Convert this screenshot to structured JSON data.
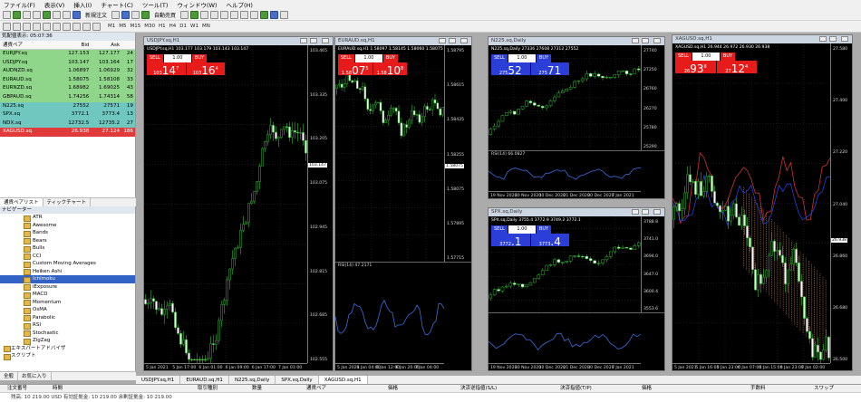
{
  "menu": [
    "ファイル(F)",
    "表示(V)",
    "挿入(I)",
    "チャート(C)",
    "ツール(T)",
    "ウィンドウ(W)",
    "ヘルプ(H)"
  ],
  "toolbar": {
    "new_order": "新規注文",
    "auto_trade": "自動売買"
  },
  "timeframes": [
    "M1",
    "M5",
    "M15",
    "M30",
    "H1",
    "H4",
    "D1",
    "W1",
    "MN"
  ],
  "market_watch": {
    "title": "気配値表示: 05:07:36",
    "headers": [
      "通貨ペア",
      "Bid",
      "Ask",
      ""
    ],
    "rows": [
      {
        "sym": "EURJPY.sq",
        "bid": "127.153",
        "ask": "127.177",
        "sp": "24",
        "bg": "#8fd68a"
      },
      {
        "sym": "USDJPY.sq",
        "bid": "103.147",
        "ask": "103.164",
        "sp": "17",
        "bg": "#8fd68a"
      },
      {
        "sym": "AUDNZD.sq",
        "bid": "1.06897",
        "ask": "1.06929",
        "sp": "32",
        "bg": "#8fd68a"
      },
      {
        "sym": "EURAUD.sq",
        "bid": "1.58075",
        "ask": "1.58108",
        "sp": "33",
        "bg": "#8fd68a"
      },
      {
        "sym": "EURNZD.sq",
        "bid": "1.68982",
        "ask": "1.69025",
        "sp": "43",
        "bg": "#8fd68a"
      },
      {
        "sym": "GBPAUD.sq",
        "bid": "1.74256",
        "ask": "1.74314",
        "sp": "58",
        "bg": "#8fd68a"
      },
      {
        "sym": "N225.sq",
        "bid": "27552",
        "ask": "27571",
        "sp": "19",
        "bg": "#6fc7bf"
      },
      {
        "sym": "SPX.sq",
        "bid": "3772.1",
        "ask": "3773.4",
        "sp": "13",
        "bg": "#6fc7bf"
      },
      {
        "sym": "NDX.sq",
        "bid": "12732.5",
        "ask": "12735.2",
        "sp": "27",
        "bg": "#6fc7bf"
      },
      {
        "sym": "XAGUSD.sq",
        "bid": "26.938",
        "ask": "27.124",
        "sp": "186",
        "bg": "#e03a3a",
        "fg": "#fff"
      }
    ],
    "tabs": [
      "通貨ペアリスト",
      "ティックチャート"
    ]
  },
  "navigator": {
    "title": "ナビゲーター",
    "items": [
      "ATR",
      "Awesome",
      "Bands",
      "Bears",
      "Bulls",
      "CCI",
      "Custom Moving Averages",
      "Heiken Ashi",
      "Ichimoku",
      "iExposure",
      "MACD",
      "Momentum",
      "OsMA",
      "Parabolic",
      "RSI",
      "Stochastic",
      "ZigZag"
    ],
    "selected": "Ichimoku",
    "roots": [
      "エキスパートアドバイザ",
      "スクリプト"
    ],
    "tabs": [
      "全般",
      "お気に入り"
    ]
  },
  "charts": {
    "usdjpy": {
      "title": "USDJPY.sq,H1",
      "info": "USDJPY.sq,H1  103.177 103.179 103.143 103.147",
      "sell": "SELL",
      "buy": "BUY",
      "lot": "1.00",
      "bid_pre": "103",
      "bid_big": "14",
      "bid_sup": "7",
      "ask_pre": "103",
      "ask_big": "16",
      "ask_sup": "4",
      "yticks": [
        "103.465",
        "103.335",
        "103.205",
        "103.075",
        "102.945",
        "102.815",
        "102.685",
        "102.555"
      ],
      "price_tag": "103.147",
      "xticks": [
        "5 Jan 2021",
        "5 Jan 17:00",
        "6 Jan 01:00",
        "6 Jan 09:00",
        "6 Jan 17:00",
        "7 Jan 01:00"
      ]
    },
    "euraud": {
      "title": "EURAUD.sq,H1",
      "info": "EURAUD.sq,H1  1.58097 1.58145 1.58060 1.58075",
      "sell": "SELL",
      "buy": "BUY",
      "lot": "1.00",
      "bid_pre": "1.58",
      "bid_big": "07",
      "bid_sup": "5",
      "ask_pre": "1.58",
      "ask_big": "10",
      "ask_sup": "8",
      "yticks": [
        "1.58795",
        "1.58615",
        "1.58435",
        "1.58255",
        "1.58075",
        "1.57895",
        "1.57715"
      ],
      "price_tag": "1.58075",
      "rsi": "RSI(14) 47.2171",
      "xticks": [
        "5 Jan 2021",
        "6 Jan 04:00",
        "6 Jan 12:00",
        "6 Jan 20:00",
        "7 Jan 04:00"
      ]
    },
    "n225": {
      "title": "N225.sq,Daily",
      "info": "N225.sq,Daily  27336 27608 27312 27552",
      "sell": "SELL",
      "buy": "BUY",
      "lot": "1.00",
      "bid_pre": "275",
      "bid_big": "52",
      "bid_sup": "",
      "ask_pre": "275",
      "ask_big": "71",
      "ask_sup": "",
      "yticks": [
        "27740",
        "27250",
        "26760",
        "26270",
        "25780",
        "25290"
      ],
      "rsi": "RSI(14) 66.0827",
      "xticks": [
        "19 Nov 2020",
        "30 Nov 2020",
        "10 Dec 2020",
        "21 Dec 2020",
        "30 Dec 2020",
        "7 Jan 2021"
      ]
    },
    "spx": {
      "title": "SPX.sq,Daily",
      "info": "SPX.sq,Daily  3755.4 3772.9 3749.2 3772.1",
      "sell": "SELL",
      "buy": "BUY",
      "lot": "1.00",
      "bid_pre": "3772",
      "bid_big": ".1",
      "bid_sup": "",
      "ask_pre": "3773",
      "ask_big": ".4",
      "ask_sup": "",
      "yticks": [
        "3788.8",
        "3741.0",
        "3694.0",
        "3647.0",
        "3600.4",
        "3553.6"
      ],
      "macd": "MACD(12,26,9) 36.7925 33.4231",
      "xticks": [
        "19 Nov 2020",
        "30 Nov 2020",
        "10 Dec 2020",
        "21 Dec 2020",
        "30 Dec 2020",
        "7 Jan 2021"
      ]
    },
    "xagusd": {
      "title": "XAGUSD.sq,H1",
      "info": "XAGUSD.sq,H1  26.944 26.972 26.930 26.938",
      "sell": "SELL",
      "buy": "BUY",
      "lot": "1.00",
      "bid_pre": "26",
      "bid_big": "93",
      "bid_sup": "8",
      "ask_pre": "27",
      "ask_big": "12",
      "ask_sup": "4",
      "yticks": [
        "27.580",
        "27.400",
        "27.220",
        "27.040",
        "26.860",
        "26.680",
        "26.500"
      ],
      "price_tag": "26.938",
      "xticks": [
        "5 Jan 2021",
        "5 Jan 16:00",
        "5 Jan 23:00",
        "6 Jan 07:00",
        "6 Jan 15:00",
        "6 Jan 23:00",
        "7 Jan 02:00"
      ]
    }
  },
  "chart_tabs": [
    "USDJPY.sq,H1",
    "EURAUD.sq,H1",
    "N225.sq,Daily",
    "SPX.sq,Daily",
    "XAGUSD.sq,H1"
  ],
  "active_chart_tab": "XAGUSD.sq,H1",
  "terminal": {
    "headers": [
      "注文番号",
      "時間",
      "取引種別",
      "数量",
      "通貨ペア",
      "価格",
      "決済逆指値(S/L)",
      "決済指値(T/P)",
      "価格",
      "手数料",
      "スワップ"
    ],
    "balance": "残高: 10 219.00 USD  有効証拠金: 10 219.00  余剰証拠金: 10 219.00"
  }
}
